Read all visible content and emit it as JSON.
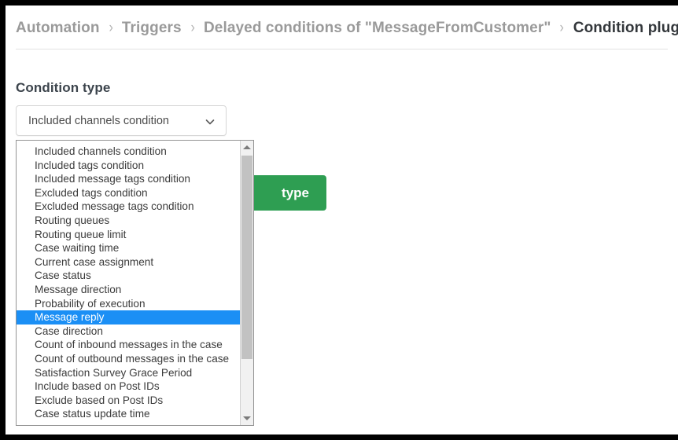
{
  "breadcrumb": {
    "separator": "›",
    "items": [
      {
        "label": "Automation",
        "current": false
      },
      {
        "label": "Triggers",
        "current": false
      },
      {
        "label": "Delayed conditions of \"MessageFromCustomer\"",
        "current": false
      },
      {
        "label": "Condition plugin",
        "current": true
      }
    ]
  },
  "main": {
    "section_heading": "Condition type",
    "save_button_label": "type",
    "accent_green": "#2e9e52",
    "highlight_blue": "#1b8ff5"
  },
  "condition_select": {
    "selected_value": "Included channels condition",
    "expanded": true,
    "arrow_icon": "chevron-down-icon",
    "options": [
      "Included channels condition",
      "Included tags condition",
      "Included message tags condition",
      "Excluded tags condition",
      "Excluded message tags condition",
      "Routing queues",
      "Routing queue limit",
      "Case waiting time",
      "Current case assignment",
      "Case status",
      "Message direction",
      "Probability of execution",
      "Message reply",
      "Case direction",
      "Count of inbound messages in the case",
      "Count of outbound messages in the case",
      "Satisfaction Survey Grace Period",
      "Include based on Post IDs",
      "Exclude based on Post IDs",
      "Case status update time"
    ],
    "highlighted_option": "Message reply",
    "scrollbar": {
      "up_arrow_icon": "scroll-up-arrow-icon",
      "down_arrow_icon": "scroll-down-arrow-icon"
    }
  }
}
